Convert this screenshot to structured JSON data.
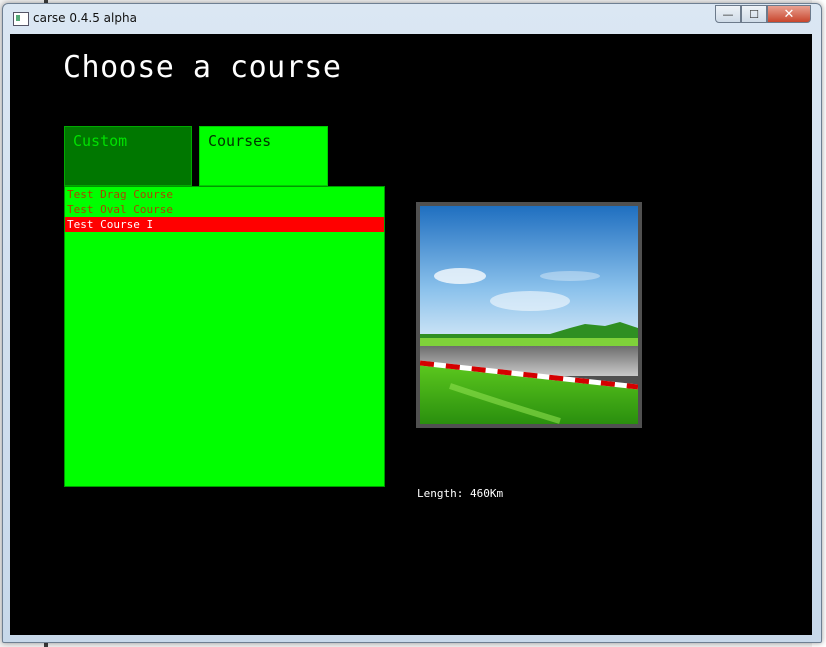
{
  "window": {
    "title": "carse 0.4.5 alpha",
    "minimize": "—",
    "maximize": "☐",
    "close": "✕"
  },
  "screen": {
    "heading": "Choose a course",
    "tabs": [
      {
        "label": "Custom",
        "active": false
      },
      {
        "label": "Courses",
        "active": true
      }
    ],
    "courses": [
      {
        "name": "Test Drag Course",
        "selected": false
      },
      {
        "name": "Test Oval Course",
        "selected": false
      },
      {
        "name": "Test Course I",
        "selected": true
      }
    ],
    "length_text": "Length: 460Km",
    "preview_icon": "race-track-landscape"
  },
  "colors": {
    "background": "#000000",
    "list_bg": "#00ff00",
    "selected_bg": "#ff0000",
    "tab_inactive": "#007700"
  }
}
